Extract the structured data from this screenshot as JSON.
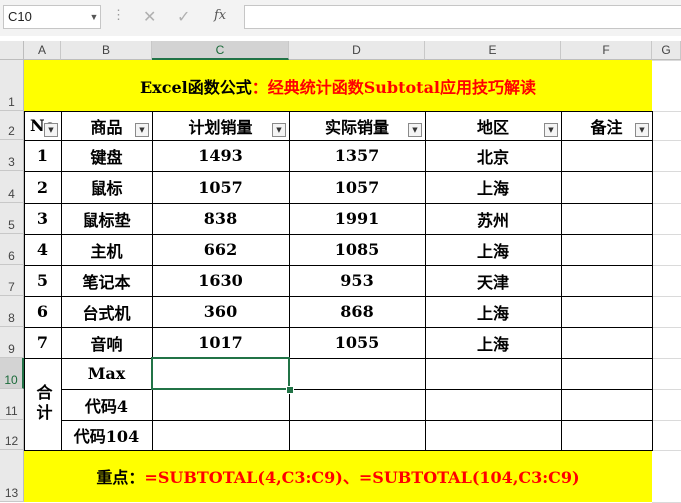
{
  "formula_bar": {
    "name_box": "C10",
    "dots": "⋮",
    "cancel_icon": "✕",
    "enter_icon": "✓",
    "fx_label": "fx",
    "formula": ""
  },
  "columns": [
    "A",
    "B",
    "C",
    "D",
    "E",
    "F",
    "G"
  ],
  "rows": [
    "1",
    "2",
    "3",
    "4",
    "5",
    "6",
    "7",
    "8",
    "9",
    "10",
    "11",
    "12",
    "13"
  ],
  "title": {
    "part1": "Excel函数公式",
    "part2": "：经典统计函数Subtotal应用技巧解读"
  },
  "headers": [
    "No",
    "商品",
    "计划销量",
    "实际销量",
    "地区",
    "备注"
  ],
  "data_rows": [
    {
      "no": "1",
      "product": "键盘",
      "plan": "1493",
      "actual": "1357",
      "region": "北京",
      "note": ""
    },
    {
      "no": "2",
      "product": "鼠标",
      "plan": "1057",
      "actual": "1057",
      "region": "上海",
      "note": ""
    },
    {
      "no": "3",
      "product": "鼠标垫",
      "plan": "838",
      "actual": "1991",
      "region": "苏州",
      "note": ""
    },
    {
      "no": "4",
      "product": "主机",
      "plan": "662",
      "actual": "1085",
      "region": "上海",
      "note": ""
    },
    {
      "no": "5",
      "product": "笔记本",
      "plan": "1630",
      "actual": "953",
      "region": "天津",
      "note": ""
    },
    {
      "no": "6",
      "product": "台式机",
      "plan": "360",
      "actual": "868",
      "region": "上海",
      "note": ""
    },
    {
      "no": "7",
      "product": "音响",
      "plan": "1017",
      "actual": "1055",
      "region": "上海",
      "note": ""
    }
  ],
  "summary": {
    "label": "合计",
    "rows": [
      "Max",
      "代码4",
      "代码104"
    ]
  },
  "footer": "重点：=SUBTOTAL(4,C3:C9)、=SUBTOTAL(104,C3:C9)",
  "colors": {
    "highlight": "#ffff00",
    "title_red": "#ff0000",
    "selection": "#217346"
  }
}
